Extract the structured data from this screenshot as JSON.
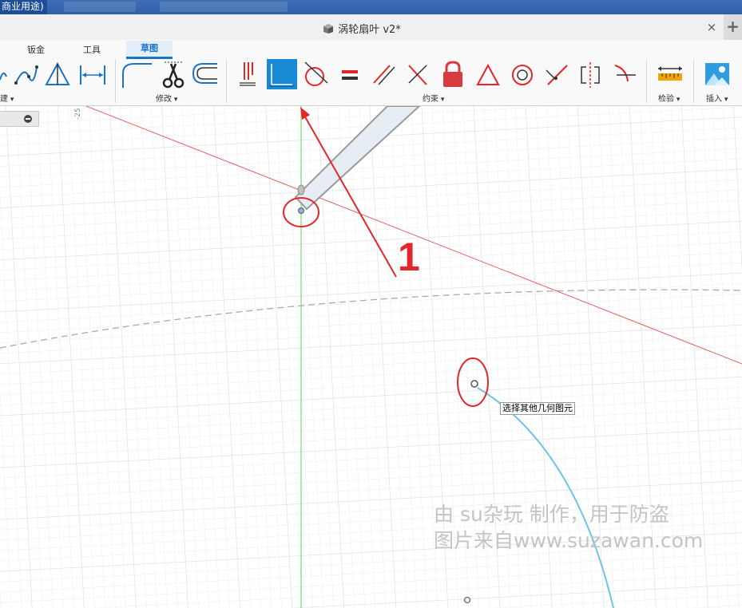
{
  "window": {
    "title_fragment": "商业用途)"
  },
  "document": {
    "title": "涡轮扇叶 v2*",
    "close_glyph": "×",
    "add_glyph": "+"
  },
  "ribbon": {
    "tabs": [
      {
        "label": "钣金"
      },
      {
        "label": "工具"
      },
      {
        "label": "草图",
        "active": true
      }
    ],
    "groups": [
      {
        "label": "创建",
        "visible": "建"
      },
      {
        "label": "修改"
      },
      {
        "label": "约束"
      },
      {
        "label": "检验"
      },
      {
        "label": "插入"
      }
    ],
    "active_tool": "coincident-constraint"
  },
  "canvas": {
    "axis_tick": "-25",
    "tooltip": "选择其他几何图元",
    "annotation_number": "1",
    "watermark": {
      "line1": "由 su杂玩 制作，用于防盗",
      "line2": "图片来自www.suzawan.com"
    }
  },
  "colors": {
    "accent": "#1a74c4",
    "annotation": "#e2262a",
    "red_axis": "#e06060",
    "green_axis": "#5cd65c",
    "curve": "#6ec3e8"
  }
}
